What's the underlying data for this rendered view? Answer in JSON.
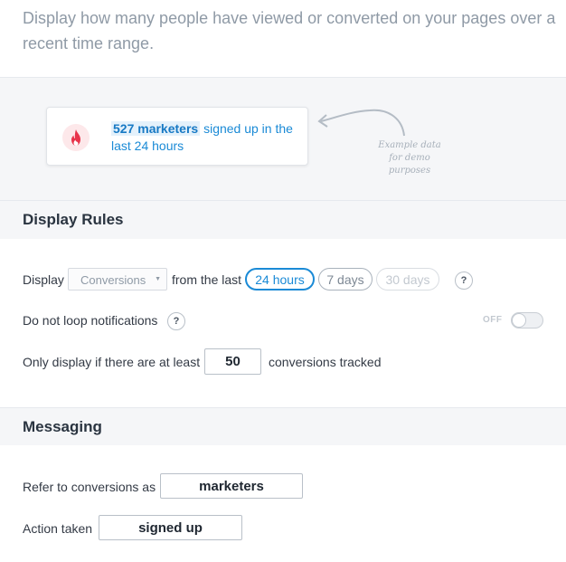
{
  "intro": {
    "text": "Display how many people have viewed or converted on your pages over a recent time range."
  },
  "preview": {
    "highlight": "527 marketers",
    "message_rest": " signed up in the last 24 hours",
    "demo_note": "Example data for demo purposes"
  },
  "display_rules": {
    "title": "Display Rules",
    "display_label": "Display",
    "select_value": "Conversions",
    "from_label": "from the last",
    "ranges": [
      "24 hours",
      "7 days",
      "30 days"
    ],
    "selected_range": "24 hours",
    "help": "?",
    "loop_label": "Do not loop notifications",
    "loop_toggle_label": "OFF",
    "loop_enabled": false,
    "min_label": "Only display if there are at least",
    "min_value": "50",
    "min_suffix": "conversions tracked"
  },
  "messaging": {
    "title": "Messaging",
    "refer_label": "Refer to conversions as",
    "refer_value": "marketers",
    "action_label": "Action taken",
    "action_value": "signed up"
  },
  "colors": {
    "accent": "#1a8ad6",
    "flame": "#e8334a",
    "section_bg": "#f5f6f8"
  },
  "icons": {
    "flame": "flame-icon",
    "arrow": "curved-arrow-icon",
    "caret": "caret-down-icon",
    "help": "help-icon"
  }
}
